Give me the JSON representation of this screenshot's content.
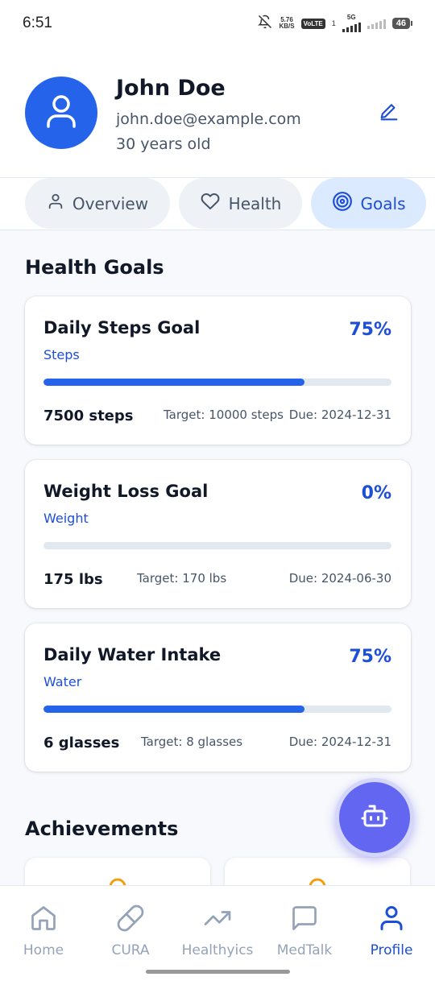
{
  "status_bar": {
    "time": "6:51",
    "net_speed_value": "5.76",
    "net_speed_unit": "KB/S",
    "volte": "VoLTE",
    "sim_index": "1",
    "network": "5G",
    "battery": "46"
  },
  "profile": {
    "name": "John Doe",
    "email": "john.doe@example.com",
    "age": "30 years old"
  },
  "tabs": [
    {
      "label": "Overview",
      "icon": "user-icon",
      "active": false
    },
    {
      "label": "Health",
      "icon": "heart-icon",
      "active": false
    },
    {
      "label": "Goals",
      "icon": "target-icon",
      "active": true
    }
  ],
  "goals_section": {
    "title": "Health Goals",
    "goals": [
      {
        "title": "Daily Steps Goal",
        "category": "Steps",
        "percent_label": "75%",
        "progress": 0.75,
        "current": "7500 steps",
        "target": "Target: 10000 steps",
        "due": "Due: 2024-12-31"
      },
      {
        "title": "Weight Loss Goal",
        "category": "Weight",
        "percent_label": "0%",
        "progress": 0.0,
        "current": "175 lbs",
        "target": "Target: 170 lbs",
        "due": "Due: 2024-06-30"
      },
      {
        "title": "Daily Water Intake",
        "category": "Water",
        "percent_label": "75%",
        "progress": 0.75,
        "current": "6 glasses",
        "target": "Target: 8 glasses",
        "due": "Due: 2024-12-31"
      }
    ]
  },
  "achievements": {
    "title": "Achievements"
  },
  "fab": {
    "icon": "bot-icon"
  },
  "bottom_nav": [
    {
      "label": "Home",
      "icon": "home-icon",
      "active": false
    },
    {
      "label": "CURA",
      "icon": "pill-icon",
      "active": false
    },
    {
      "label": "Healthyics",
      "icon": "trending-up-icon",
      "active": false
    },
    {
      "label": "MedTalk",
      "icon": "chat-icon",
      "active": false
    },
    {
      "label": "Profile",
      "icon": "user-icon",
      "active": true
    }
  ],
  "colors": {
    "primary": "#2563eb",
    "primary_text": "#1d4ed8",
    "fab": "#6366f1",
    "track": "#e2e8f0",
    "muted": "#94a3b8"
  }
}
